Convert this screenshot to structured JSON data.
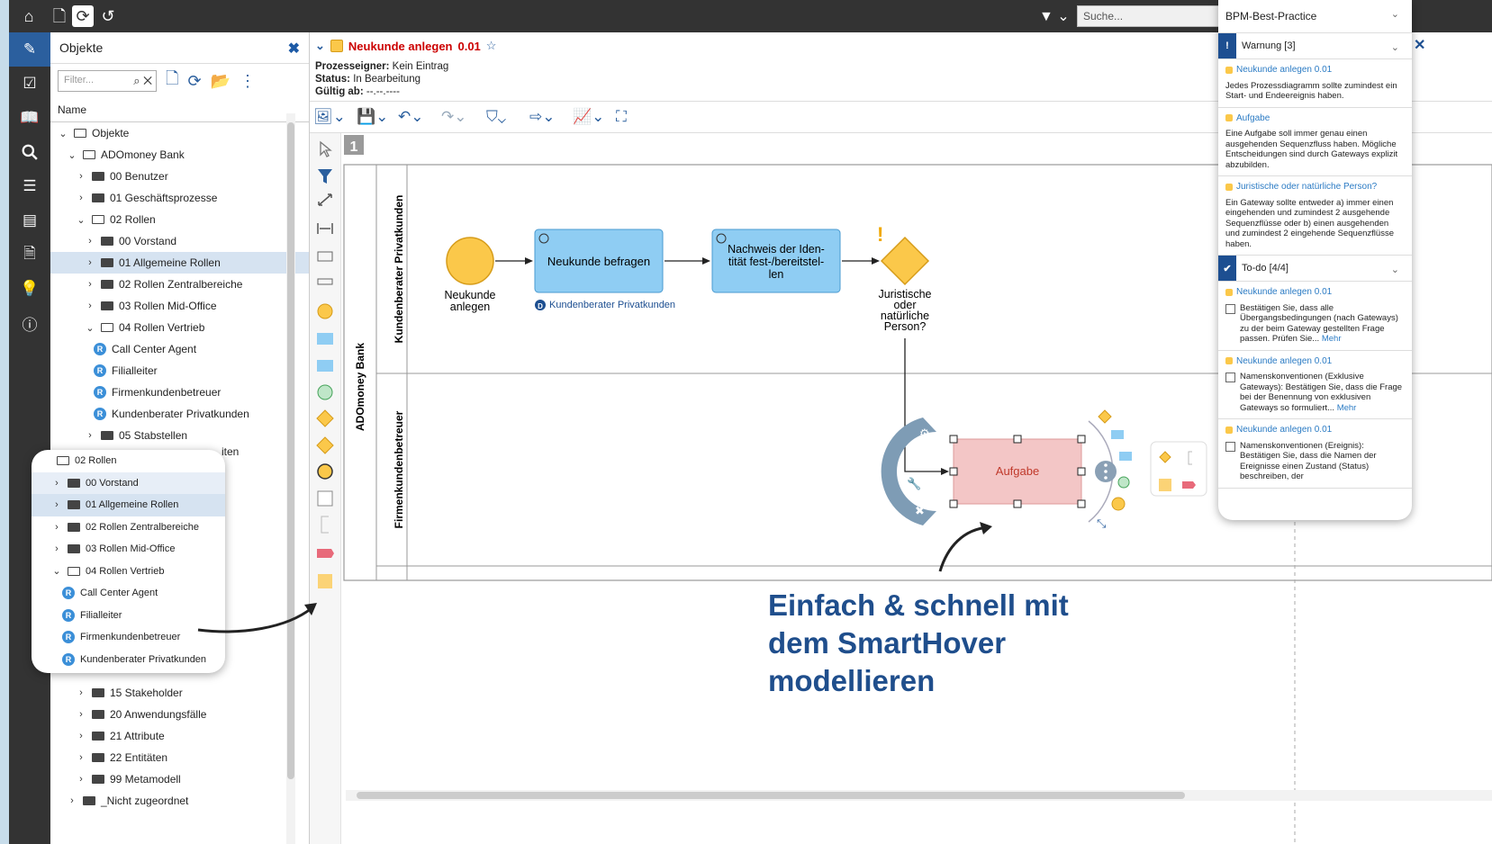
{
  "topbar": {
    "search_placeholder": "Suche...",
    "icons": [
      "home-icon",
      "new-doc-icon",
      "refresh-icon",
      "history-icon"
    ]
  },
  "sidebar": {
    "icons": [
      "edit-icon",
      "checklist-icon",
      "book-icon",
      "search-icon",
      "list-icon",
      "card-icon",
      "document-icon",
      "bulb-icon",
      "info-icon"
    ]
  },
  "objects_panel": {
    "title": "Objekte",
    "filter_placeholder": "Filter...",
    "column_header": "Name",
    "tree": [
      {
        "label": "Objekte",
        "level": 0,
        "type": "folder-open",
        "chev": "down"
      },
      {
        "label": "ADOmoney Bank",
        "level": 1,
        "type": "folder-open",
        "chev": "down"
      },
      {
        "label": "00 Benutzer",
        "level": 2,
        "type": "folder",
        "chev": "right"
      },
      {
        "label": "01 Geschäftsprozesse",
        "level": 2,
        "type": "folder",
        "chev": "right"
      },
      {
        "label": "02 Rollen",
        "level": 2,
        "type": "folder-open",
        "chev": "down"
      },
      {
        "label": "00 Vorstand",
        "level": 3,
        "type": "folder",
        "chev": "right"
      },
      {
        "label": "01 Allgemeine Rollen",
        "level": 3,
        "type": "folder",
        "chev": "right",
        "selected": true
      },
      {
        "label": "02 Rollen Zentralbereiche",
        "level": 3,
        "type": "folder",
        "chev": "right"
      },
      {
        "label": "03 Rollen Mid-Office",
        "level": 3,
        "type": "folder",
        "chev": "right"
      },
      {
        "label": "04 Rollen Vertrieb",
        "level": 3,
        "type": "folder-open",
        "chev": "down"
      },
      {
        "label": "Call Center Agent",
        "level": 4,
        "type": "role"
      },
      {
        "label": "Filialleiter",
        "level": 4,
        "type": "role"
      },
      {
        "label": "Firmenkundenbetreuer",
        "level": 4,
        "type": "role"
      },
      {
        "label": "Kundenberater Privatkunden",
        "level": 4,
        "type": "role"
      },
      {
        "label": "05 Stabstellen",
        "level": 3,
        "type": "folder",
        "chev": "right"
      }
    ],
    "tree_hidden_tail": "iten",
    "tree_bottom": [
      {
        "label": "15 Stakeholder",
        "level": 2,
        "type": "folder",
        "chev": "right"
      },
      {
        "label": "20 Anwendungsfälle",
        "level": 2,
        "type": "folder",
        "chev": "right"
      },
      {
        "label": "21 Attribute",
        "level": 2,
        "type": "folder",
        "chev": "right"
      },
      {
        "label": "22 Entitäten",
        "level": 2,
        "type": "folder",
        "chev": "right"
      },
      {
        "label": "99 Metamodell",
        "level": 2,
        "type": "folder",
        "chev": "right"
      },
      {
        "label": "_Nicht zugeordnet",
        "level": 1,
        "type": "folder",
        "chev": "right"
      }
    ]
  },
  "zoom_popup": {
    "items": [
      {
        "label": "02 Rollen",
        "level": 0,
        "type": "folder-open"
      },
      {
        "label": "00 Vorstand",
        "level": 1,
        "type": "folder",
        "chev": "right",
        "hl": true
      },
      {
        "label": "01 Allgemeine Rollen",
        "level": 1,
        "type": "folder",
        "chev": "right",
        "selected": true
      },
      {
        "label": "02 Rollen Zentralbereiche",
        "level": 1,
        "type": "folder",
        "chev": "right"
      },
      {
        "label": "03 Rollen Mid-Office",
        "level": 1,
        "type": "folder",
        "chev": "right"
      },
      {
        "label": "04 Rollen Vertrieb",
        "level": 1,
        "type": "folder-open",
        "chev": "down"
      },
      {
        "label": "Call Center Agent",
        "level": 2,
        "type": "role"
      },
      {
        "label": "Filialleiter",
        "level": 2,
        "type": "role"
      },
      {
        "label": "Firmenkundenbetreuer",
        "level": 2,
        "type": "role"
      },
      {
        "label": "Kundenberater Privatkunden",
        "level": 2,
        "type": "role"
      }
    ]
  },
  "process": {
    "title": "Neukunde anlegen",
    "version": "0.01",
    "owner_label": "Prozesseigner:",
    "owner_value": "Kein Eintrag",
    "status_label": "Status:",
    "status_value": "In Bearbeitung",
    "valid_label": "Gültig ab:",
    "valid_value": "--.--.----"
  },
  "diagram": {
    "page_number": "1",
    "pool": "ADOmoney Bank",
    "lane1": "Kundenberater Privatkunden",
    "lane2": "Firmenkundenbetreuer",
    "start_event": [
      "Neukunde",
      "anlegen"
    ],
    "task1": "Neukunde befragen",
    "task2": [
      "Nachweis der Iden-",
      "tität fest-/bereitstel-",
      "len"
    ],
    "role_link": "Kundenberater Privatkunden",
    "role_badge": "D",
    "gateway": [
      "Juristische",
      "oder",
      "natürliche",
      "Person?"
    ],
    "new_task": "Aufgabe",
    "warning_mark": "!"
  },
  "callout": [
    "Einfach & schnell mit",
    "dem SmartHover",
    "modellieren"
  ],
  "right_panel": {
    "title": "BPM-Best-Practice",
    "warn_section": "Warnung [3]",
    "warn_badge": "!",
    "warnings": [
      {
        "title": "Neukunde anlegen 0.01",
        "text": "Jedes Prozessdiagramm sollte zumindest ein Start- und Endeereignis haben."
      },
      {
        "title": "Aufgabe",
        "text": "Eine Aufgabe soll immer genau einen ausgehenden Sequenzfluss haben. Mögliche Entscheidungen sind durch Gateways explizit abzubilden."
      },
      {
        "title": "Juristische oder natürliche Person?",
        "text": "Ein Gateway sollte entweder a) immer einen eingehenden und zumindest 2 ausgehende Sequenzflüsse oder b) einen ausgehenden und zumindest 2 eingehende Sequenzflüsse haben."
      }
    ],
    "todo_section": "To-do [4/4]",
    "todo_badge": "✔",
    "more_label": "Mehr",
    "todos": [
      {
        "title": "Neukunde anlegen 0.01",
        "text": "Bestätigen Sie, dass alle Übergangsbedingungen (nach Gateways) zu der beim Gateway gestellten Frage passen. Prüfen Sie..."
      },
      {
        "title": "Neukunde anlegen 0.01",
        "text": "Namenskonventionen (Exklusive Gateways): Bestätigen Sie, dass die Frage bei der Benennung von exklusiven Gateways so formuliert..."
      },
      {
        "title": "Neukunde anlegen 0.01",
        "text": "Namenskonventionen (Ereignis): Bestätigen Sie, dass die Namen der Ereignisse einen Zustand (Status) beschreiben, der"
      }
    ]
  },
  "colors": {
    "accent": "#1d4f91",
    "task": "#8fcdf3",
    "event": "#fbc84a",
    "error_task": "#f3c6c6",
    "title_red": "#cc0000",
    "callout": "#1f4e8c"
  }
}
